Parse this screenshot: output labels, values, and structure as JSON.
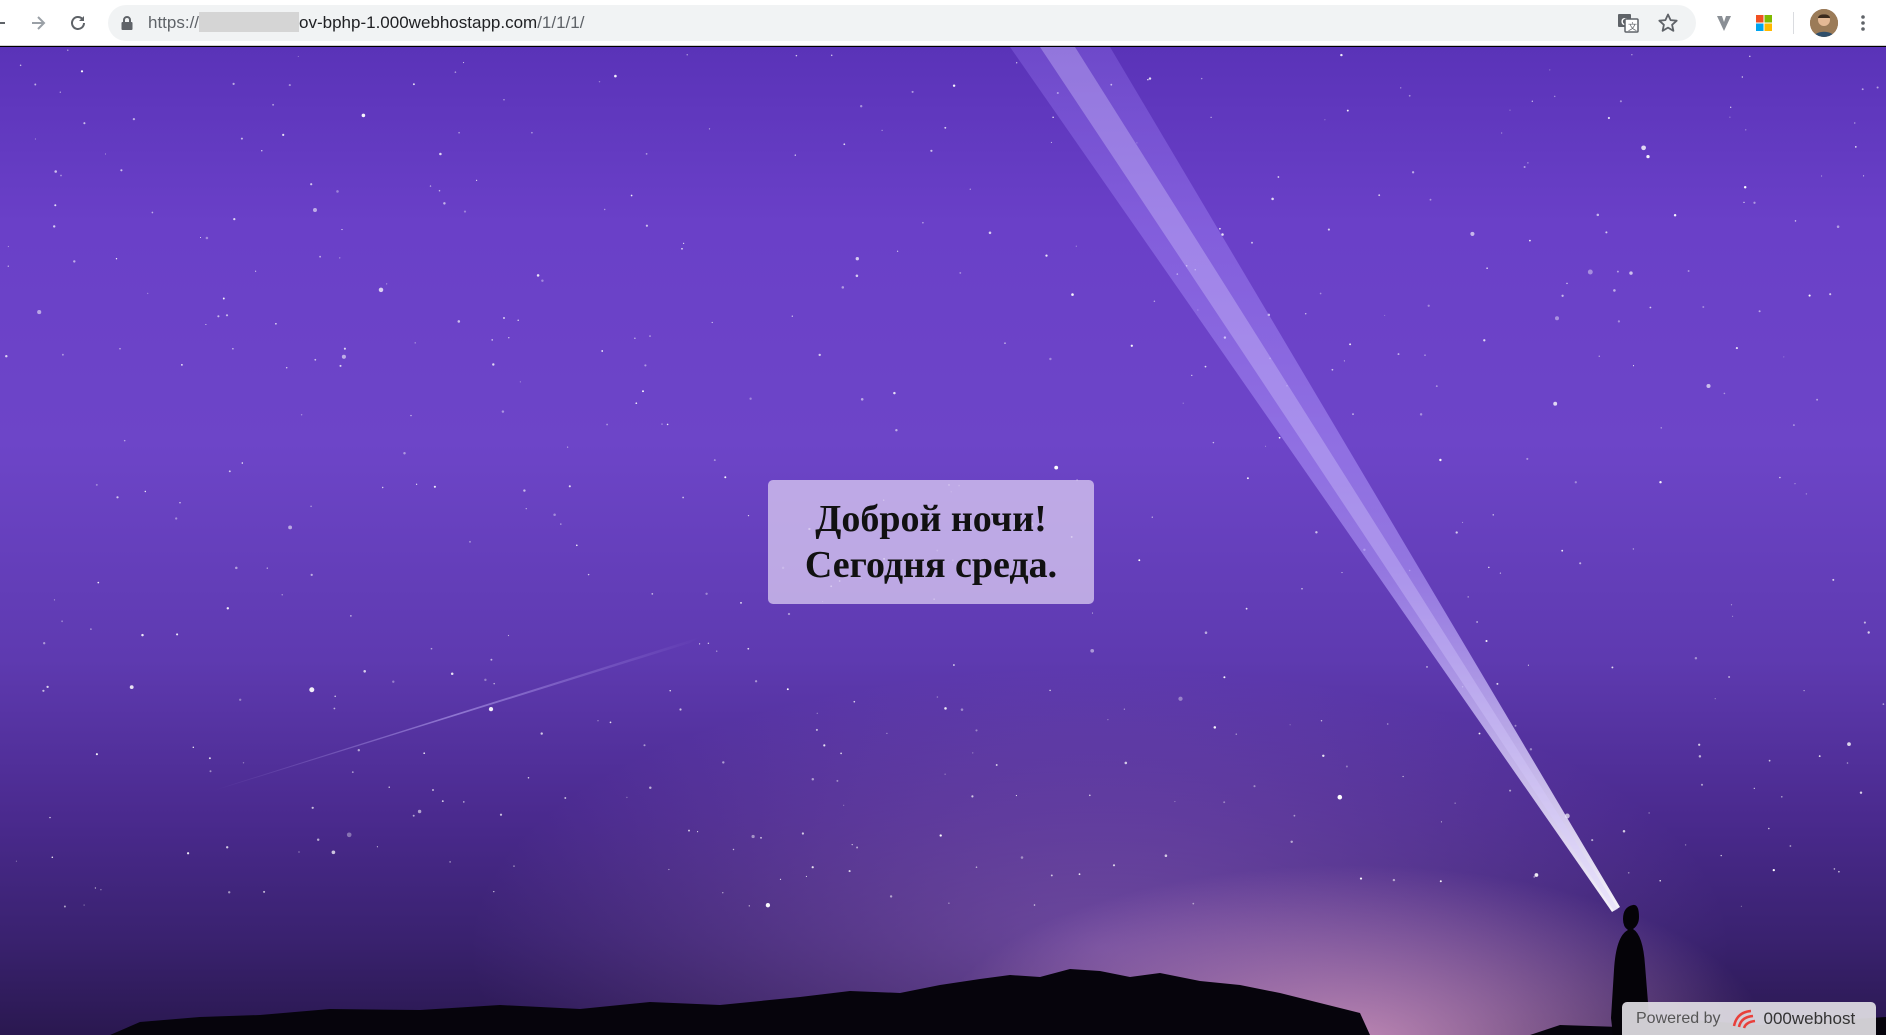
{
  "browser": {
    "url_scheme": "https://",
    "url_host": "ov-bphp-1.000webhostapp.com",
    "url_path": "/1/1/1/"
  },
  "page": {
    "greeting_line1": "Доброй ночи!",
    "greeting_line2": "Сегодня среда."
  },
  "badge": {
    "powered_by": "Powered by",
    "brand": "000webhost"
  },
  "icons": {
    "toolbar": [
      "back-icon",
      "forward-icon",
      "reload-icon",
      "lock-icon",
      "translate-icon",
      "star-icon",
      "vivaldi-extension-icon",
      "windows-extension-icon",
      "avatar",
      "more-vert-icon"
    ],
    "badge": [
      "000webhost-logo-icon"
    ]
  },
  "colors": {
    "sky_top": "#5a33b8",
    "sky_mid": "#6d45c8",
    "beam": "#b9a3ff",
    "greeting_box": "#d6c6f0",
    "brand_logo": "#e8403b"
  }
}
